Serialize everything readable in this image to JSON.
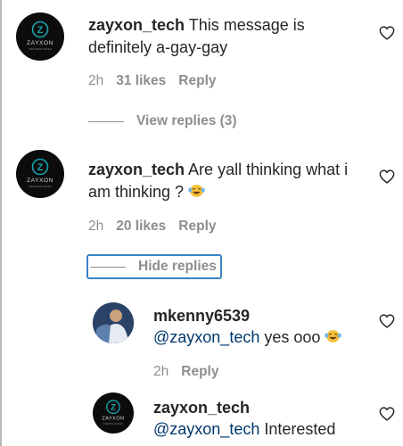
{
  "comments": [
    {
      "username": "zayxon_tech",
      "text": " This message is definitely a-gay-gay",
      "time": "2h",
      "likes": "31 likes",
      "reply": "Reply",
      "toggle": "View replies (3)"
    },
    {
      "username": "zayxon_tech",
      "text": " Are yall thinking what i am thinking ? ",
      "time": "2h",
      "likes": "20 likes",
      "reply": "Reply",
      "toggle": "Hide replies"
    }
  ],
  "replies": [
    {
      "username": "mkenny6539",
      "mention": "@zayxon_tech",
      "text": " yes ooo ",
      "time": "2h",
      "reply": "Reply"
    },
    {
      "username": "zayxon_tech",
      "mention": "@zayxon_tech",
      "text": " Interested"
    }
  ],
  "avatar_logo": {
    "word": "ZAYXON",
    "tagline": "TECHNOLOGIES"
  },
  "colors": {
    "text": "#262626",
    "meta": "#8e8e8e",
    "mention": "#00376b",
    "focus": "#3b82c4",
    "logo": "#19a3b0"
  },
  "icons": [
    "heart-icon",
    "laughing-emoji-icon",
    "zayxon-logo-icon"
  ]
}
